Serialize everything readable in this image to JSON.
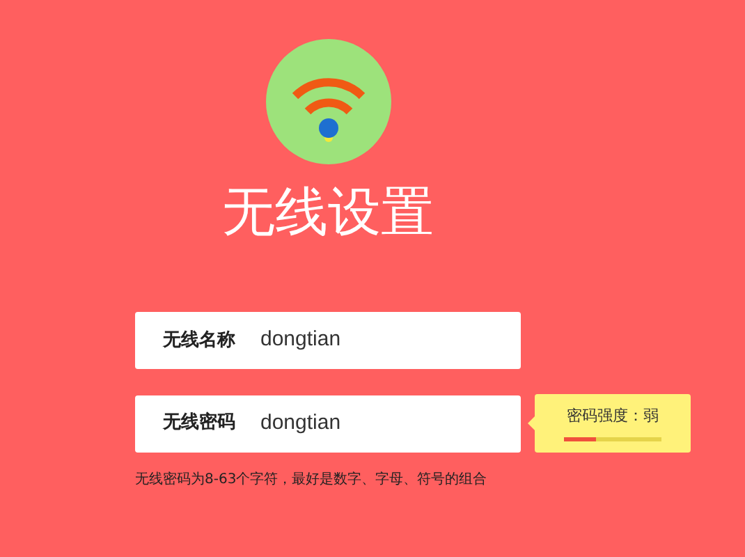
{
  "title": "无线设置",
  "fields": [
    {
      "label": "无线名称",
      "value": "dongtian"
    },
    {
      "label": "无线密码",
      "value": "dongtian"
    }
  ],
  "strength": {
    "label": "密码强度：弱",
    "level": 0.33
  },
  "hint": "无线密码为8-63个字符，最好是数字、字母、符号的组合"
}
